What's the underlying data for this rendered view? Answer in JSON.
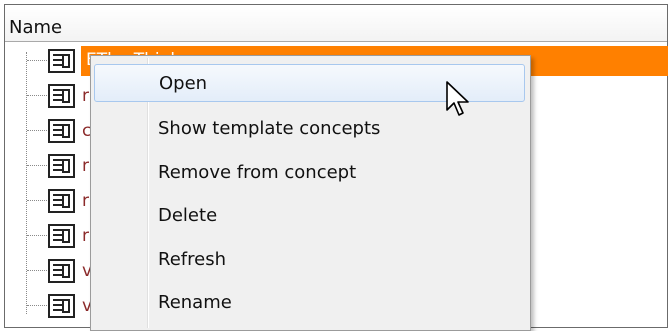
{
  "tree": {
    "column_header": "Name",
    "rows": [
      {
        "icon": "document-icon",
        "text": "EThe Thinke"
      },
      {
        "icon": "document-icon",
        "text": "r"
      },
      {
        "icon": "document-icon",
        "text": "c"
      },
      {
        "icon": "document-icon",
        "text": "r"
      },
      {
        "icon": "document-icon",
        "text": "r"
      },
      {
        "icon": "document-icon",
        "text": "r"
      },
      {
        "icon": "document-icon",
        "text": "v"
      },
      {
        "icon": "document-icon",
        "text": "v"
      }
    ],
    "selected_color": "#ff8000"
  },
  "context_menu": {
    "items": [
      {
        "label": "Open"
      },
      {
        "label": "Show template concepts"
      },
      {
        "label": "Remove from concept"
      },
      {
        "label": "Delete"
      },
      {
        "label": "Refresh"
      },
      {
        "label": "Rename"
      }
    ],
    "hovered_item": "Open"
  },
  "cursor": {
    "icon": "arrow-cursor-icon"
  }
}
